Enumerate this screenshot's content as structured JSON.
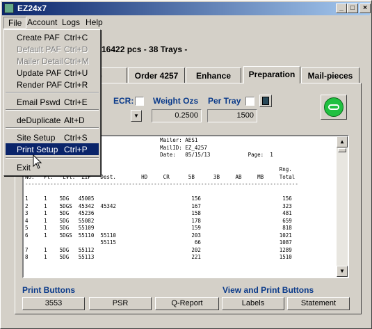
{
  "window": {
    "title": "EZ24x7"
  },
  "menubar": {
    "file": "File",
    "account": "Account",
    "logs": "Logs",
    "help": "Help"
  },
  "file_menu": {
    "create_paf": {
      "label": "Create PAF",
      "accel": "Ctrl+C"
    },
    "default_paf": {
      "label": "Default PAF",
      "accel": "Ctrl+D"
    },
    "mailer_detail": {
      "label": "Mailer Detail",
      "accel": "Ctrl+M"
    },
    "update_paf": {
      "label": "Update PAF",
      "accel": "Ctrl+U"
    },
    "render_paf": {
      "label": "Render PAF",
      "accel": "Ctrl+R"
    },
    "email_pswd": {
      "label": "Email Pswd",
      "accel": "Ctrl+E"
    },
    "deduplicate": {
      "label": "deDuplicate",
      "accel": "Alt+D"
    },
    "site_setup": {
      "label": "Site Setup",
      "accel": "Ctrl+S"
    },
    "print_setup": {
      "label": "Print Setup",
      "accel": "Ctrl+P"
    },
    "exit": {
      "label": "Exit"
    }
  },
  "header": {
    "summary": "16422 pcs - 38 Trays -"
  },
  "tabs": {
    "tab1": "e",
    "tab2": "Order 4257",
    "tab3": "Enhance",
    "tab4": "Preparation",
    "tab5": "Mail-pieces"
  },
  "form": {
    "ecr_label": "ECR:",
    "weight_label": "Weight Ozs",
    "weight_value": "0.2500",
    "pertray_label": "Per Tray",
    "pertray_value": "1500"
  },
  "report": {
    "lines": [
      "          ort                              Mailer: AES1",
      "                                           MailID: EZ_4257",
      "          45.6 / 245.7                     Date:   05/15/13            Page:  1",
      "",
      "Tray  Cont  Dest  Group                                                          Rng.",
      "No.   Pt.  *Lvl.  ZIP   Dest.        HD     CR      5B      3B     AB     MB     Total",
      "---------------------------------------------------------------------------------------",
      "",
      "1     1    5DG   45005                               156                          156",
      "2     1    5DGS  45342  45342                        167                          323",
      "3     1    5DG   45236                               158                          481",
      "4     1    5DG   55082                               178                          659",
      "5     1    5DG   55109                               159                          818",
      "6     1    5DGS  55110  55110                        203                         1021",
      "                        55115                         66                         1087",
      "7     1    5DG   55112                               202                         1289",
      "8     1    5DG   55113                               221                         1510"
    ]
  },
  "print_section": {
    "print_buttons_label": "Print Buttons",
    "view_print_label": "View and Print Buttons",
    "btn_3553": "3553",
    "btn_psr": "PSR",
    "btn_qreport": "Q-Report",
    "btn_labels": "Labels",
    "btn_statement": "Statement"
  }
}
